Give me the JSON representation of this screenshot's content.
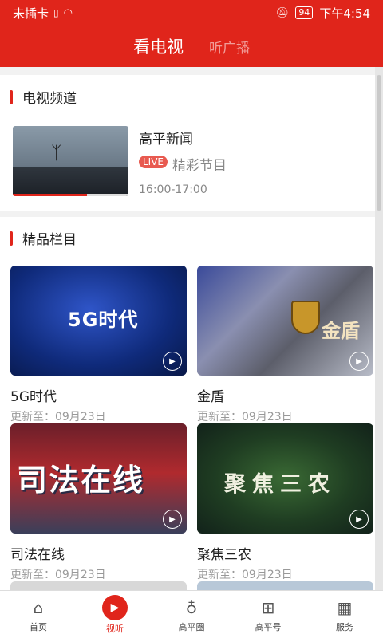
{
  "status": {
    "carrier": "未插卡",
    "battery": "94",
    "time": "下午4:54"
  },
  "header": {
    "tabs": [
      {
        "label": "看电视"
      },
      {
        "label": "听广播"
      }
    ]
  },
  "tv_section": {
    "title": "电视频道",
    "channel": {
      "name": "高平新闻",
      "live": "LIVE",
      "program": "精彩节目",
      "time": "16:00-17:00",
      "progress": 0.64
    }
  },
  "featured": {
    "title": "精品栏目",
    "cards": [
      {
        "title": "5G时代",
        "updated": "更新至：09月23日",
        "img_text": "5G时代"
      },
      {
        "title": "金盾",
        "updated": "更新至：09月23日",
        "img_text": "金盾"
      },
      {
        "title": "司法在线",
        "updated": "更新至：09月23日",
        "img_text": "司法在线"
      },
      {
        "title": "聚焦三农",
        "updated": "更新至：09月23日",
        "img_text": "聚焦三农"
      }
    ]
  },
  "nav": {
    "items": [
      {
        "label": "首页",
        "icon": "home-icon"
      },
      {
        "label": "视听",
        "icon": "tv-icon"
      },
      {
        "label": "高平圈",
        "icon": "planet-icon"
      },
      {
        "label": "高平号",
        "icon": "bookmark-plus-icon"
      },
      {
        "label": "服务",
        "icon": "grid-icon"
      }
    ]
  },
  "colors": {
    "brand": "#e0251b"
  }
}
